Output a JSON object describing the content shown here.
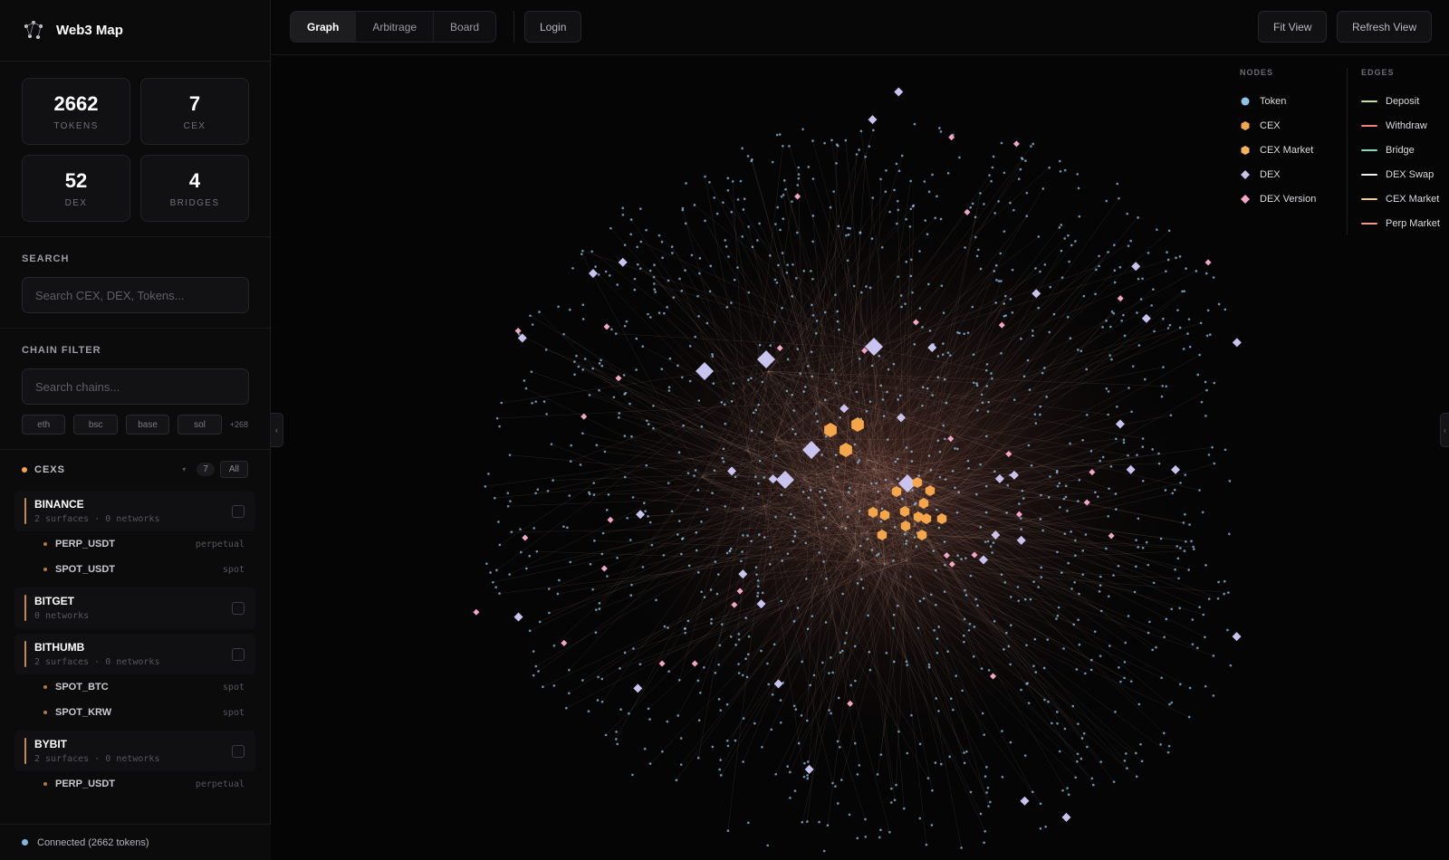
{
  "brand": {
    "title": "Web3 Map"
  },
  "stats": [
    {
      "value": "2662",
      "label": "TOKENS"
    },
    {
      "value": "7",
      "label": "CEX"
    },
    {
      "value": "52",
      "label": "DEX"
    },
    {
      "value": "4",
      "label": "BRIDGES"
    }
  ],
  "search": {
    "title": "SEARCH",
    "placeholder": "Search CEX, DEX, Tokens..."
  },
  "chain_filter": {
    "title": "CHAIN FILTER",
    "placeholder": "Search chains...",
    "chips": [
      "eth",
      "bsc",
      "base",
      "sol"
    ],
    "more": "+268"
  },
  "cexs": {
    "title": "CEXS",
    "count": "7",
    "all_label": "All",
    "items": [
      {
        "name": "BINANCE",
        "sub": "2 surfaces · 0 networks",
        "surfaces": [
          {
            "name": "PERP_USDT",
            "kind": "perpetual"
          },
          {
            "name": "SPOT_USDT",
            "kind": "spot"
          }
        ]
      },
      {
        "name": "BITGET",
        "sub": "0 networks",
        "surfaces": []
      },
      {
        "name": "BITHUMB",
        "sub": "2 surfaces · 0 networks",
        "surfaces": [
          {
            "name": "SPOT_BTC",
            "kind": "spot"
          },
          {
            "name": "SPOT_KRW",
            "kind": "spot"
          }
        ]
      },
      {
        "name": "BYBIT",
        "sub": "2 surfaces · 0 networks",
        "surfaces": [
          {
            "name": "PERP_USDT",
            "kind": "perpetual"
          }
        ]
      }
    ]
  },
  "status": {
    "text": "Connected (2662 tokens)"
  },
  "topbar": {
    "tabs": [
      "Graph",
      "Arbitrage",
      "Board"
    ],
    "active_tab": "Graph",
    "login": "Login",
    "fit_view": "Fit View",
    "refresh_view": "Refresh View"
  },
  "legend": {
    "nodes_title": "NODES",
    "edges_title": "EDGES",
    "nodes": [
      {
        "label": "Token",
        "shape": "circle",
        "color": "#8fc3e6"
      },
      {
        "label": "CEX",
        "shape": "hexagon",
        "color": "#f5a54a"
      },
      {
        "label": "CEX Market",
        "shape": "hexagon",
        "color": "#f7b35c"
      },
      {
        "label": "DEX",
        "shape": "diamond",
        "color": "#c9c3ef"
      },
      {
        "label": "DEX Version",
        "shape": "diamond",
        "color": "#f5a6c8"
      }
    ],
    "edges": [
      {
        "label": "Deposit",
        "color": "#c9e58a"
      },
      {
        "label": "Withdraw",
        "color": "#f08080"
      },
      {
        "label": "Bridge",
        "color": "#86d6c0"
      },
      {
        "label": "DEX Swap",
        "color": "#f2f2f2"
      },
      {
        "label": "CEX Market",
        "color": "#f7c98a"
      },
      {
        "label": "Perp Market",
        "color": "#f39a8a"
      }
    ]
  },
  "colors": {
    "token": "#8fc3e6",
    "cex": "#f5a54a",
    "dex": "#c9c3ef",
    "dex_version": "#f5a6c8",
    "edge": "#e3b6a4"
  }
}
